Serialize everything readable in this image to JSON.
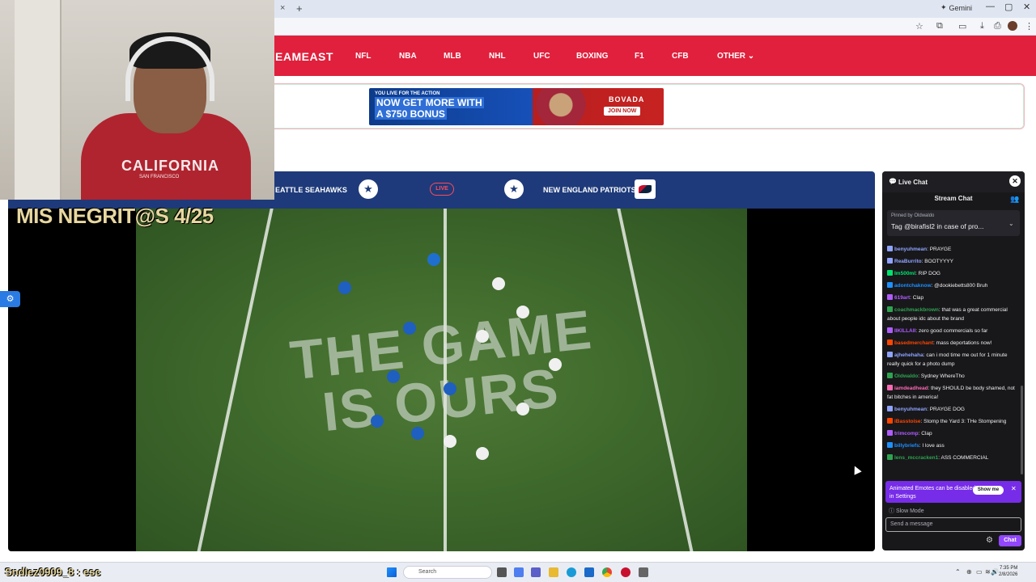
{
  "browser": {
    "tab_close": "×",
    "tab_new": "+",
    "gemini_label": "Gemini",
    "window_controls": [
      "—",
      "▢",
      "✕"
    ]
  },
  "site": {
    "brand": "EAMEAST",
    "nav": [
      "NFL",
      "NBA",
      "MLB",
      "NHL",
      "UFC",
      "BOXING",
      "F1",
      "CFB",
      "OTHER ⌄"
    ]
  },
  "ad": {
    "small": "YOU LIVE FOR THE ACTION",
    "line1": "NOW GET MORE WITH",
    "line2": "A $750 BONUS",
    "brand": "BOVADA",
    "cta": "JOIN NOW"
  },
  "match": {
    "home": "EATTLE SEAHAWKS",
    "away": "NEW ENGLAND PATRIOTS",
    "live": "LIVE",
    "star": "★"
  },
  "video": {
    "overlay": "MIS NEGRIT@S 4/25",
    "overlay_sub": "",
    "field_text_1": "THE GAME",
    "field_text_2": "IS OURS",
    "settings_icon": "⚙"
  },
  "webcam": {
    "shirt_text": "CALIFORNIA",
    "shirt_sub": "SAN FRANCISCO"
  },
  "chat": {
    "title": "Live Chat",
    "close": "✕",
    "stream_chat": "Stream Chat",
    "pinned_meta": "Pinned by  Oldwaldo",
    "pinned_text": "Tag @birafisl2 in case of pro...",
    "messages": [
      {
        "user": "benyuhmean",
        "text": "PRAYGE",
        "color": "#8fa3ff"
      },
      {
        "user": "ReaBurrito",
        "text": "BOOTYYYY",
        "color": "#8fa3ff"
      },
      {
        "user": "Im500ml",
        "text": "RIP DOG",
        "color": "#00e36c"
      },
      {
        "user": "adontchaknow",
        "text": "@dookiebetts800 Bruh",
        "color": "#1e90ff"
      },
      {
        "user": "619art",
        "text": "Clap",
        "color": "#b05cff"
      },
      {
        "user": "coachmackbrown",
        "text": "that was a great commercial about people idc about the brand",
        "color": "#2ea44f"
      },
      {
        "user": "IIKILLAII",
        "text": "zero good commercials so far",
        "color": "#b05cff"
      },
      {
        "user": "basedmerchant",
        "text": "mass deportations now!",
        "color": "#ff4500"
      },
      {
        "user": "ajhehehaha",
        "text": "can i mod time me out for 1 minute really quick for a photo dump",
        "color": "#8fa3ff"
      },
      {
        "user": "Oldwaldo",
        "text": "Sydney WhereTho",
        "color": "#2ea44f"
      },
      {
        "user": "iamdeadhead",
        "text": "they SHOULD be body shamed, not fat bitches in america!",
        "color": "#ff69b4"
      },
      {
        "user": "benyuhmean",
        "text": "PRAYGE DOG",
        "color": "#8fa3ff"
      },
      {
        "user": "iBasstoise",
        "text": "Stomp the Yard 3: THe Stompening",
        "color": "#ff4500"
      },
      {
        "user": "trimcomp",
        "text": "Clap",
        "color": "#b05cff"
      },
      {
        "user": "billybriefs",
        "text": "I love ass",
        "color": "#1e90ff"
      },
      {
        "user": "lens_mccracken1",
        "text": "ASS COMMERCIAL",
        "color": "#2ea44f"
      }
    ],
    "notice": "Animated Emotes can be disabled in Settings",
    "show_me": "Show me",
    "notice_close": "✕",
    "slow_mode": "Slow Mode",
    "input_placeholder": "Send a message",
    "chat_button": "Chat"
  },
  "taskbar": {
    "handle": "Sndlez0909_8 : esc",
    "search": "Search",
    "time": "7:35 PM",
    "date": "2/8/2026"
  }
}
